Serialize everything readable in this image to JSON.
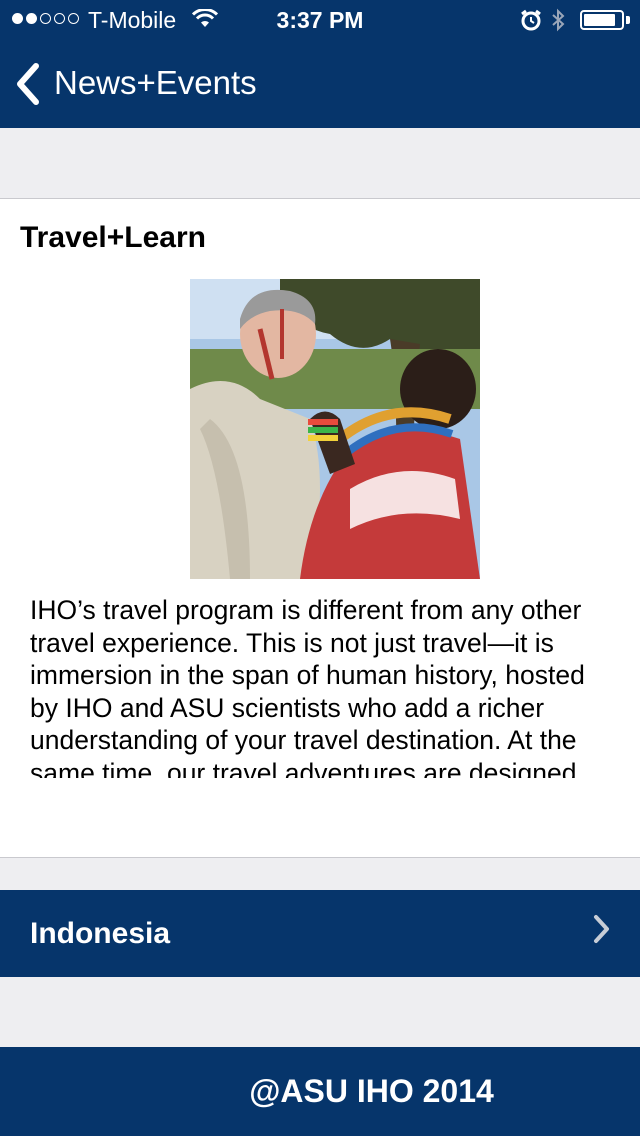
{
  "status_bar": {
    "carrier": "T-Mobile",
    "time": "3:37 PM",
    "signal_bars": 2,
    "signal_total": 5,
    "battery_level": 0.85,
    "icons": [
      "wifi-icon",
      "alarm-icon",
      "bluetooth-icon",
      "battery-icon"
    ]
  },
  "nav": {
    "back_label": "News+Events",
    "back_icon": "chevron-left-icon"
  },
  "article": {
    "title": "Travel+Learn",
    "photo_alt": "photo",
    "body_lines": [
      "IHO’s travel program is different from any other",
      "travel experience. This is not just travel—it is",
      "immersion in the span of human history, hosted",
      "by IHO and ASU scientists who add a richer",
      "understanding of your travel destination. At the",
      "same time, our travel adventures are designed"
    ]
  },
  "list": {
    "items": [
      {
        "label": "Indonesia",
        "icon": "chevron-right-icon"
      }
    ]
  },
  "footer": {
    "text": "@ASU IHO 2014"
  },
  "colors": {
    "brand_navy": "#06356b",
    "page_bg": "#eeeef1",
    "card_bg": "#ffffff",
    "text": "#000000",
    "on_brand_text": "#ffffff"
  }
}
